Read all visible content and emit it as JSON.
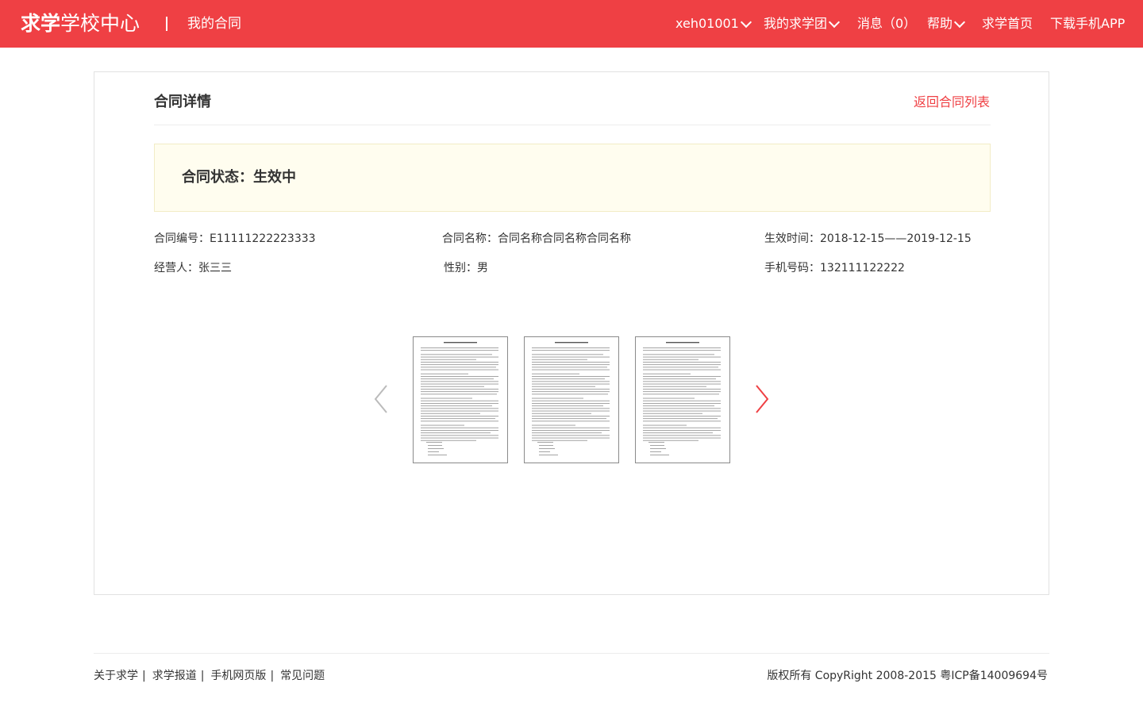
{
  "header": {
    "logo_strong": "求学",
    "logo_light": "学校中心",
    "page_name": "我的合同",
    "nav": [
      {
        "label": "xeh01001"
      },
      {
        "label": "我的求学团"
      },
      {
        "label": "消息（0）"
      },
      {
        "label": "帮助"
      },
      {
        "label": "求学首页"
      },
      {
        "label": "下载手机APP"
      }
    ]
  },
  "panel": {
    "title": "合同详情",
    "back_label": "返回合同列表",
    "status": "合同状态：生效中",
    "info": [
      "合同编号：E11111222223333",
      "合同名称：合同名称合同名称合同名称",
      "生效时间：2018-12-15——2019-12-15",
      "经营人：张三三",
      "性别：男",
      "手机号码：132111122222"
    ]
  },
  "footer": {
    "links": [
      "关于求学",
      "求学报道",
      "手机网页版",
      "常见问题"
    ],
    "separator": "|",
    "copyright": "版权所有 CopyRight 2008-2015 粤ICP备14009694号"
  },
  "colors": {
    "brand": "#ef4044",
    "status_bg": "#fffdef",
    "arrow_prev": "#bbbbbb",
    "arrow_next": "#ef4044"
  }
}
